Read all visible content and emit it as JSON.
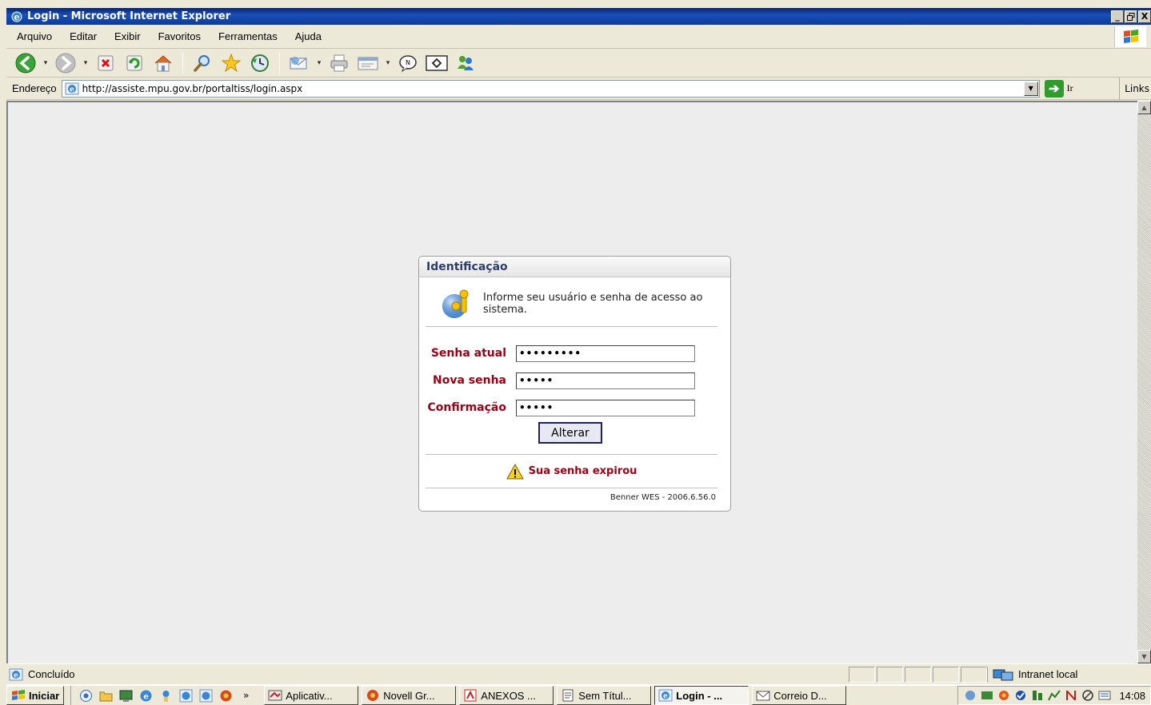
{
  "window": {
    "title": "Login - Microsoft Internet Explorer",
    "minimize": "_",
    "restore": "̲",
    "close": "X"
  },
  "menu": {
    "items": [
      "Arquivo",
      "Editar",
      "Exibir",
      "Favoritos",
      "Ferramentas",
      "Ajuda"
    ]
  },
  "address": {
    "label": "Endereço",
    "url": "http://assiste.mpu.gov.br/portaltiss/login.aspx",
    "go_label": "Ir",
    "links_label": "Links"
  },
  "login": {
    "header": "Identificação",
    "info": "Informe seu usuário e senha de acesso ao sistema.",
    "fields": [
      {
        "label": "Senha atual",
        "value": "•••••••••"
      },
      {
        "label": "Nova senha",
        "value": "•••••"
      },
      {
        "label": "Confirmação",
        "value": "•••••"
      }
    ],
    "button": "Alterar",
    "message": "Sua senha expirou",
    "footer": "Benner WES - 2006.6.56.0"
  },
  "status": {
    "text": "Concluído",
    "zone": "Intranet local"
  },
  "taskbar": {
    "start": "Iniciar",
    "overflow": "»",
    "tasks": [
      {
        "label": "Aplicativ...",
        "active": false
      },
      {
        "label": "Novell Gr...",
        "active": false
      },
      {
        "label": "ANEXOS ...",
        "active": false
      },
      {
        "label": "Sem Títul...",
        "active": false
      },
      {
        "label": "Login - ...",
        "active": true
      },
      {
        "label": "Correio D...",
        "active": false
      }
    ],
    "clock": "14:08"
  },
  "colors": {
    "title_bar": "#0a246a",
    "label_red": "#a00014",
    "header_blue": "#2c3d6e",
    "content_bg": "#ededed"
  }
}
